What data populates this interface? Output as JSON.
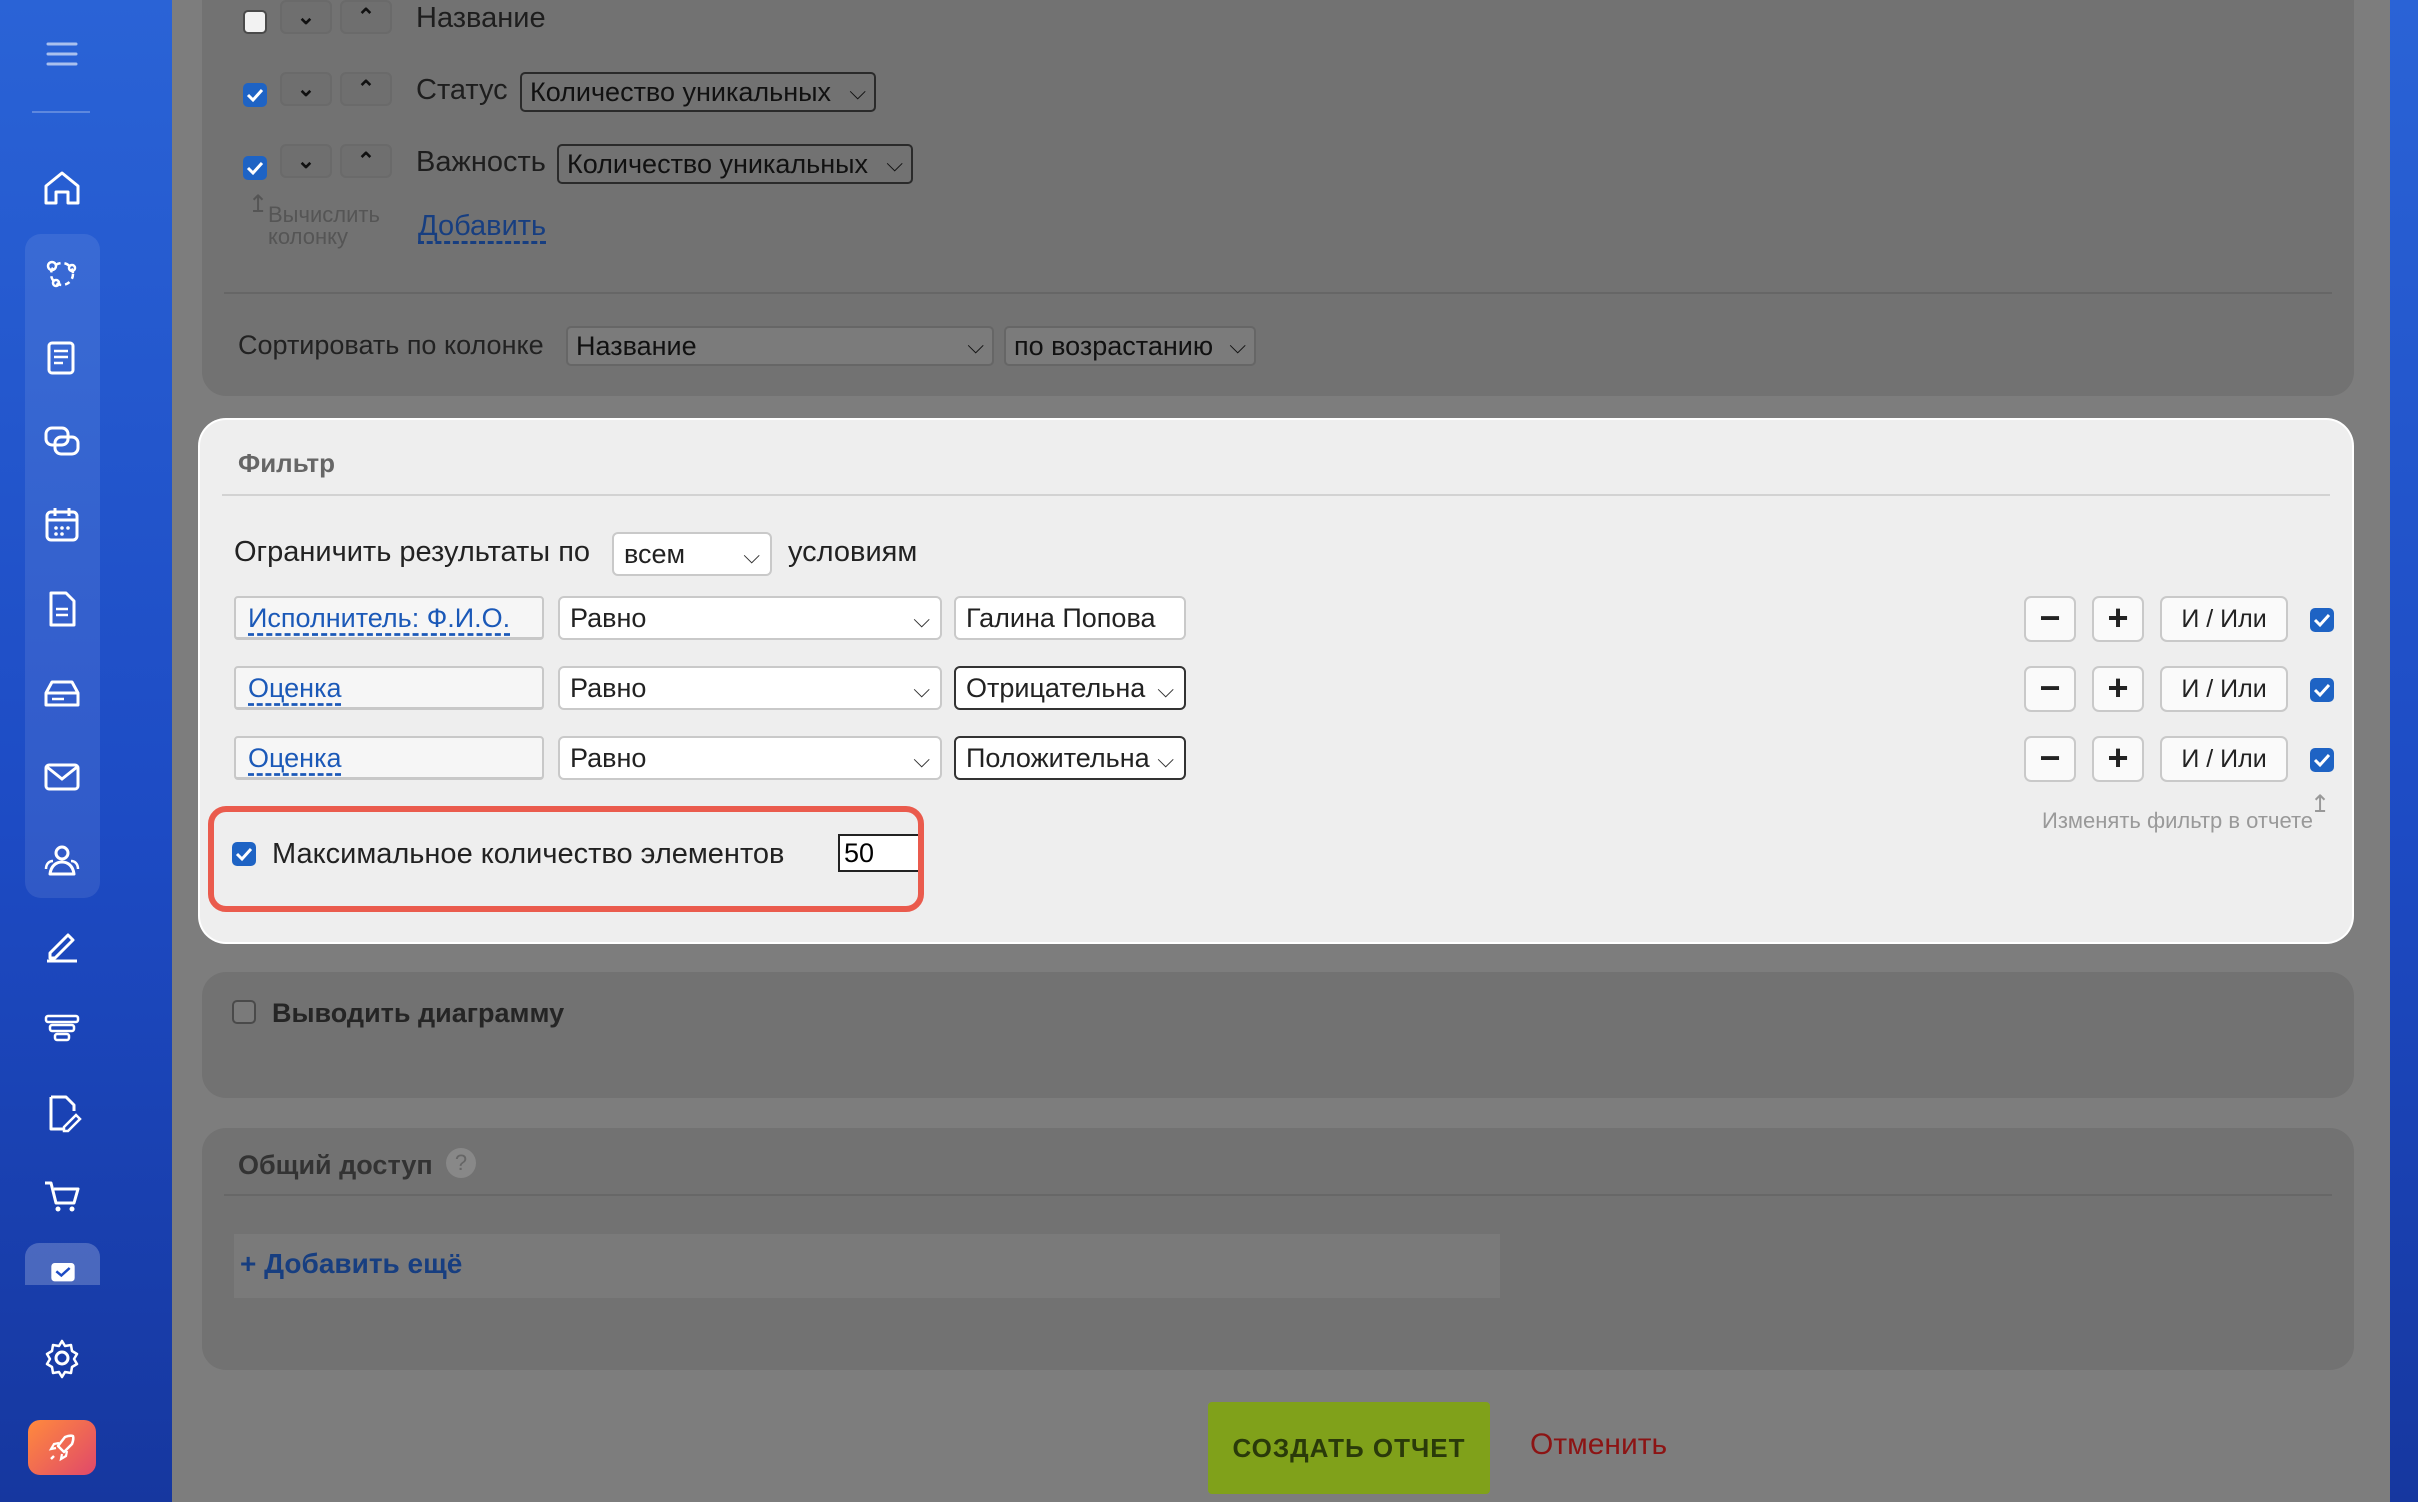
{
  "sidebar": {
    "icons": [
      "menu-icon",
      "home-icon",
      "crm-icon",
      "feed-icon",
      "chat-icon",
      "calendar-icon",
      "document-icon",
      "drive-icon",
      "mail-icon",
      "contacts-icon",
      "sign-icon",
      "funnel-icon",
      "tasks-doc-icon",
      "cart-icon",
      "tasks-icon",
      "settings-icon",
      "rocket-icon"
    ]
  },
  "columns": {
    "rows": [
      {
        "name": "Название",
        "checked": false,
        "func": ""
      },
      {
        "name": "Статус",
        "checked": true,
        "func": "Количество уникальных"
      },
      {
        "name": "Важность",
        "checked": true,
        "func": "Количество уникальных"
      }
    ],
    "calc_hint": "Вычислить колонку",
    "add_link": "Добавить",
    "sort_label": "Сортировать по колонке",
    "sort_column": "Название",
    "sort_order": "по возрастанию"
  },
  "filter": {
    "title": "Фильтр",
    "limit_prefix": "Ограничить результаты по",
    "limit_value": "всем",
    "limit_suffix": "условиям",
    "rows": [
      {
        "field": "Исполнитель: Ф.И.О.",
        "op": "Равно",
        "value": "Галина Попова",
        "value_is_select": false
      },
      {
        "field": "Оценка",
        "op": "Равно",
        "value": "Отрицательна",
        "value_is_select": true
      },
      {
        "field": "Оценка",
        "op": "Равно",
        "value": "Положительна",
        "value_is_select": true
      }
    ],
    "minus_label": "−",
    "plus_label": "+",
    "andor_label": "И / Или",
    "change_hint": "Изменять фильтр в отчете",
    "max_label": "Максимальное количество элементов",
    "max_value": "50",
    "max_checked": true
  },
  "chart": {
    "label": "Выводить диаграмму",
    "checked": false
  },
  "access": {
    "title": "Общий доступ",
    "help": "?",
    "add_more": "+ Добавить ещё"
  },
  "actions": {
    "create": "СОЗДАТЬ ОТЧЕТ",
    "cancel": "Отменить"
  },
  "colors": {
    "accent": "#1e63c4",
    "highlight": "#ea5b4d",
    "create_button": "#80a11a",
    "cancel_text": "#8c1414"
  }
}
